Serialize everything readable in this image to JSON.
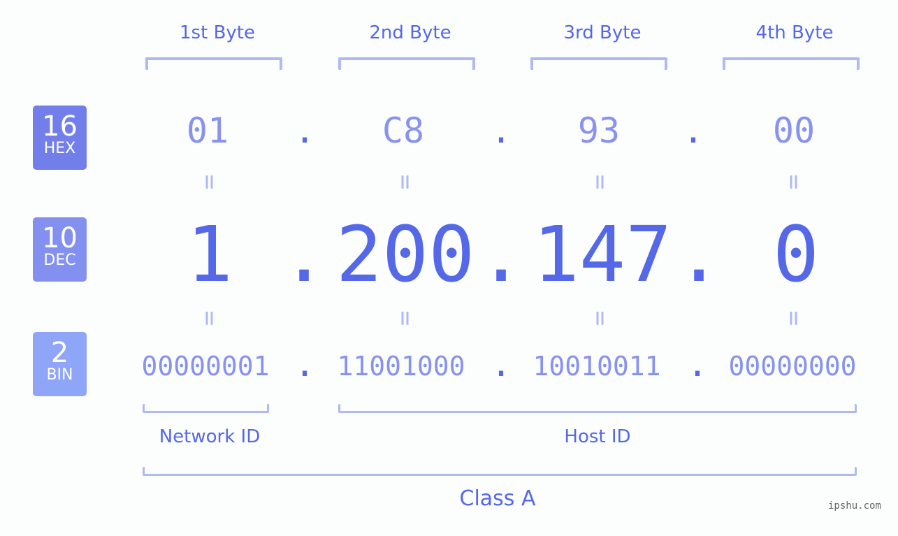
{
  "bases": [
    {
      "num": "16",
      "label": "HEX",
      "color": "#727fea"
    },
    {
      "num": "10",
      "label": "DEC",
      "color": "#8390ef"
    },
    {
      "num": "2",
      "label": "BIN",
      "color": "#8fa5f7"
    }
  ],
  "byte_headers": [
    "1st Byte",
    "2nd Byte",
    "3rd Byte",
    "4th Byte"
  ],
  "hex": [
    "01",
    "C8",
    "93",
    "00"
  ],
  "dec": [
    "1",
    "200",
    "147",
    "0"
  ],
  "bin": [
    "00000001",
    "11001000",
    "10010011",
    "00000000"
  ],
  "separator": ".",
  "equals": "=",
  "network_label": "Network ID",
  "host_label": "Host ID",
  "class_label": "Class A",
  "watermark": "ipshu.com"
}
